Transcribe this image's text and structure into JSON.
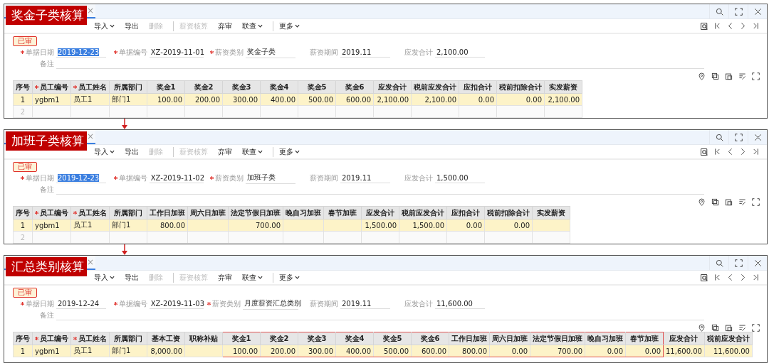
{
  "panels": [
    {
      "caption": "奖金子类核算",
      "tab_close": "×",
      "status": "已审",
      "toolbar": [
        {
          "label": "导入",
          "dropdown": true,
          "disabled": false,
          "divider_before": false
        },
        {
          "label": "导出",
          "dropdown": false,
          "disabled": false,
          "divider_before": false
        },
        {
          "label": "删除",
          "dropdown": false,
          "disabled": true,
          "divider_before": false
        },
        {
          "label": "薪资核算",
          "dropdown": false,
          "disabled": true,
          "divider_before": true
        },
        {
          "label": "弃审",
          "dropdown": false,
          "disabled": false,
          "divider_before": false
        },
        {
          "label": "联查",
          "dropdown": true,
          "disabled": false,
          "divider_before": false
        },
        {
          "label": "更多",
          "dropdown": true,
          "disabled": false,
          "divider_before": true
        }
      ],
      "fields": [
        {
          "label": "单据日期",
          "value": "2019-12-23",
          "required": true,
          "selected": true
        },
        {
          "label": "单据编号",
          "value": "XZ-2019-11-01",
          "required": true,
          "selected": false
        },
        {
          "label": "薪资类别",
          "value": "奖金子类",
          "required": true,
          "selected": false
        },
        {
          "label": "薪资期间",
          "value": "2019.11",
          "required": false,
          "selected": false
        },
        {
          "label": "应发合计",
          "value": "2,100.00",
          "required": false,
          "selected": false
        }
      ],
      "remark_label": "备注",
      "columns": [
        {
          "label": "序号",
          "required": false
        },
        {
          "label": "员工编号",
          "required": true
        },
        {
          "label": "员工姓名",
          "required": true
        },
        {
          "label": "所属部门",
          "required": false
        },
        {
          "label": "奖金1",
          "required": false
        },
        {
          "label": "奖金2",
          "required": false
        },
        {
          "label": "奖金3",
          "required": false
        },
        {
          "label": "奖金4",
          "required": false
        },
        {
          "label": "奖金5",
          "required": false
        },
        {
          "label": "奖金6",
          "required": false
        },
        {
          "label": "应发合计",
          "required": false
        },
        {
          "label": "税前应发合计",
          "required": false
        },
        {
          "label": "应扣合计",
          "required": false
        },
        {
          "label": "税前扣除合计",
          "required": false
        },
        {
          "label": "实发薪资",
          "required": false
        }
      ],
      "rows": [
        {
          "selected": true,
          "cells": [
            "1",
            "ygbm1",
            "员工1",
            "部门1",
            "100.00",
            "200.00",
            "300.00",
            "400.00",
            "500.00",
            "600.00",
            "2,100.00",
            "2,100.00",
            "0.00",
            "0.00",
            "2,100.00"
          ]
        },
        {
          "selected": false,
          "cells": [
            "2"
          ]
        }
      ]
    },
    {
      "caption": "加班子类核算",
      "tab_close": "×",
      "status": "已审",
      "toolbar": [
        {
          "label": "导入",
          "dropdown": true,
          "disabled": false,
          "divider_before": false
        },
        {
          "label": "导出",
          "dropdown": false,
          "disabled": false,
          "divider_before": false
        },
        {
          "label": "删除",
          "dropdown": false,
          "disabled": true,
          "divider_before": false
        },
        {
          "label": "薪资核算",
          "dropdown": false,
          "disabled": true,
          "divider_before": true
        },
        {
          "label": "弃审",
          "dropdown": false,
          "disabled": false,
          "divider_before": false
        },
        {
          "label": "联查",
          "dropdown": true,
          "disabled": false,
          "divider_before": false
        },
        {
          "label": "更多",
          "dropdown": true,
          "disabled": false,
          "divider_before": true
        }
      ],
      "fields": [
        {
          "label": "单据日期",
          "value": "2019-12-23",
          "required": true,
          "selected": true
        },
        {
          "label": "单据编号",
          "value": "XZ-2019-11-02",
          "required": true,
          "selected": false
        },
        {
          "label": "薪资类别",
          "value": "加班子类",
          "required": true,
          "selected": false
        },
        {
          "label": "薪资期间",
          "value": "2019.11",
          "required": false,
          "selected": false
        },
        {
          "label": "应发合计",
          "value": "1,500.00",
          "required": false,
          "selected": false
        }
      ],
      "remark_label": "备注",
      "columns": [
        {
          "label": "序号",
          "required": false
        },
        {
          "label": "员工编号",
          "required": true
        },
        {
          "label": "员工姓名",
          "required": true
        },
        {
          "label": "所属部门",
          "required": false
        },
        {
          "label": "工作日加班",
          "required": false
        },
        {
          "label": "周六日加班",
          "required": false
        },
        {
          "label": "法定节假日加班",
          "required": false
        },
        {
          "label": "晚自习加班",
          "required": false
        },
        {
          "label": "春节加班",
          "required": false
        },
        {
          "label": "应发合计",
          "required": false
        },
        {
          "label": "税前应发合计",
          "required": false
        },
        {
          "label": "应扣合计",
          "required": false
        },
        {
          "label": "税前扣除合计",
          "required": false
        },
        {
          "label": "实发薪资",
          "required": false
        }
      ],
      "rows": [
        {
          "selected": true,
          "cells": [
            "1",
            "ygbm1",
            "员工1",
            "部门1",
            "800.00",
            null,
            "700.00",
            null,
            null,
            "1,500.00",
            "1,500.00",
            "0.00",
            "0.00",
            null
          ]
        },
        {
          "selected": false,
          "cells": [
            "2"
          ]
        }
      ]
    },
    {
      "caption": "汇总类别核算",
      "tab_close": "×",
      "status": "已审",
      "toolbar": [
        {
          "label": "导入",
          "dropdown": true,
          "disabled": false,
          "divider_before": false
        },
        {
          "label": "导出",
          "dropdown": false,
          "disabled": false,
          "divider_before": false
        },
        {
          "label": "删除",
          "dropdown": false,
          "disabled": true,
          "divider_before": false
        },
        {
          "label": "薪资核算",
          "dropdown": false,
          "disabled": true,
          "divider_before": true
        },
        {
          "label": "弃审",
          "dropdown": false,
          "disabled": false,
          "divider_before": false
        },
        {
          "label": "联查",
          "dropdown": true,
          "disabled": false,
          "divider_before": false
        },
        {
          "label": "更多",
          "dropdown": true,
          "disabled": false,
          "divider_before": true
        }
      ],
      "fields": [
        {
          "label": "单据日期",
          "value": "2019-12-24",
          "required": true,
          "selected": false
        },
        {
          "label": "单据编号",
          "value": "XZ-2019-11-03",
          "required": true,
          "selected": false
        },
        {
          "label": "薪资类别",
          "value": "月度薪资汇总类别",
          "required": true,
          "selected": false
        },
        {
          "label": "薪资期间",
          "value": "2019.11",
          "required": false,
          "selected": false
        },
        {
          "label": "应发合计",
          "value": "11,600.00",
          "required": false,
          "selected": false
        }
      ],
      "remark_label": "备注",
      "columns": [
        {
          "label": "序号",
          "required": false,
          "highlighted": false
        },
        {
          "label": "员工编号",
          "required": true,
          "highlighted": false
        },
        {
          "label": "员工姓名",
          "required": true,
          "highlighted": false
        },
        {
          "label": "所属部门",
          "required": false,
          "highlighted": false
        },
        {
          "label": "基本工资",
          "required": false,
          "highlighted": false
        },
        {
          "label": "职称补贴",
          "required": false,
          "highlighted": false
        },
        {
          "label": "奖金1",
          "required": false,
          "highlighted": true
        },
        {
          "label": "奖金2",
          "required": false,
          "highlighted": true
        },
        {
          "label": "奖金3",
          "required": false,
          "highlighted": true
        },
        {
          "label": "奖金4",
          "required": false,
          "highlighted": true
        },
        {
          "label": "奖金5",
          "required": false,
          "highlighted": true
        },
        {
          "label": "奖金6",
          "required": false,
          "highlighted": true
        },
        {
          "label": "工作日加班",
          "required": false,
          "highlighted": true
        },
        {
          "label": "周六日加班",
          "required": false,
          "highlighted": true
        },
        {
          "label": "法定节假日加班",
          "required": false,
          "highlighted": true
        },
        {
          "label": "晚自习加班",
          "required": false,
          "highlighted": true
        },
        {
          "label": "春节加班",
          "required": false,
          "highlighted": true
        },
        {
          "label": "应发合计",
          "required": false,
          "highlighted": false
        },
        {
          "label": "税前应发合计",
          "required": false,
          "highlighted": false
        }
      ],
      "rows": [
        {
          "selected": true,
          "cells": [
            "1",
            "ygbm1",
            "员工1",
            "部门1",
            "8,000.00",
            null,
            "100.00",
            "200.00",
            "300.00",
            "400.00",
            "500.00",
            "600.00",
            "800.00",
            "0.00",
            "700.00",
            "0.00",
            "0.00",
            "11,600.00",
            "11,600.00"
          ]
        }
      ]
    }
  ]
}
